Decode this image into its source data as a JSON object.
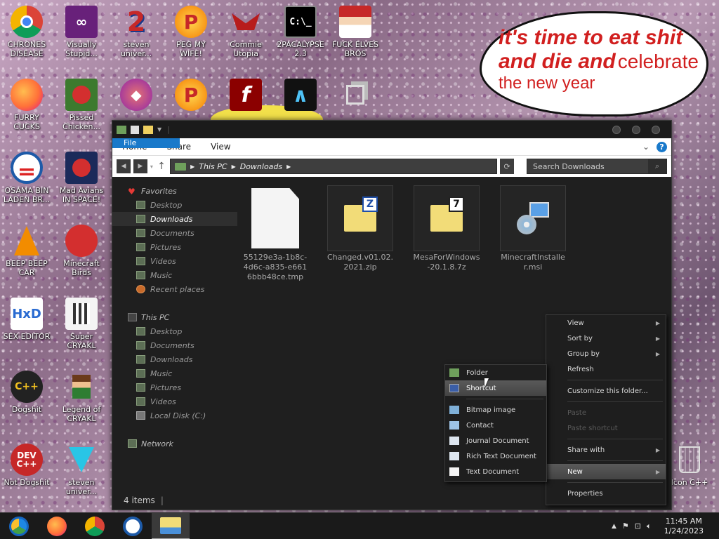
{
  "desktop": {
    "icons": [
      {
        "label": "CHRONES DISEASE",
        "icon": "chrome-icon"
      },
      {
        "label": "Visually Stupid...",
        "icon": "visual-studio-icon"
      },
      {
        "label": "steven univer...",
        "icon": "number-2-icon"
      },
      {
        "label": "PEG MY WIFE!",
        "icon": "p-letter-icon"
      },
      {
        "label": "Commie Utopia",
        "icon": "red-bird-icon"
      },
      {
        "label": "2PACALYPSE 2.3",
        "icon": "console-icon"
      },
      {
        "label": "FUCK ELVES BROS",
        "icon": "santa-icon"
      },
      {
        "label": "FURRY CUCKS",
        "icon": "firefox-icon"
      },
      {
        "label": "Pissed Chicken...",
        "icon": "angry-birds-seasons-icon"
      },
      {
        "label": "OSAMA BIN LADEN BR...",
        "icon": "obama-logo-icon"
      },
      {
        "label": "Mad Avians IN SPACE!",
        "icon": "angry-birds-space-icon"
      },
      {
        "label": "BEEP BEEP CAR",
        "icon": "vlc-cone-icon"
      },
      {
        "label": "Minecraft Birds",
        "icon": "angry-bird-icon"
      },
      {
        "label": "SEX EDITOR",
        "icon": "hxd-icon"
      },
      {
        "label": "Super CRYAKL",
        "icon": "pixel-character-icon"
      },
      {
        "label": "Dogshit",
        "icon": "cpp-dog-icon"
      },
      {
        "label": "Legend of CRYAKL",
        "icon": "pixel-hero-icon"
      },
      {
        "label": "Not Dogshit",
        "icon": "dev-cpp-icon"
      },
      {
        "label": "steven univer...",
        "icon": "gem-icon"
      },
      {
        "label": "Icon C++",
        "icon": "recycle-bin-icon"
      }
    ]
  },
  "bubble": {
    "line1": "it's time to eat shit",
    "line2a": "and die and",
    "line2b": "celebrate",
    "line3": "the new year"
  },
  "explorer": {
    "ribbon_tabs": [
      "File",
      "Home",
      "Share",
      "View"
    ],
    "breadcrumb": [
      "This PC",
      "Downloads"
    ],
    "search_placeholder": "Search Downloads",
    "nav": {
      "favorites": "Favorites",
      "favorites_items": [
        "Desktop",
        "Downloads",
        "Documents",
        "Pictures",
        "Videos",
        "Music",
        "Recent places"
      ],
      "this_pc": "This PC",
      "this_pc_items": [
        "Desktop",
        "Documents",
        "Downloads",
        "Music",
        "Pictures",
        "Videos",
        "Local Disk (C:)"
      ],
      "network": "Network",
      "selected": "Downloads"
    },
    "files": [
      {
        "name": "55129e3a-1b8c-4d6c-a835-e6616bbb48ce.tmp",
        "type": "tmp"
      },
      {
        "name": "Changed.v01.02.2021.zip",
        "type": "zip"
      },
      {
        "name": "MesaForWindows-20.1.8.7z",
        "type": "7z"
      },
      {
        "name": "MinecraftInstaller.msi",
        "type": "msi"
      }
    ],
    "status": "4 items"
  },
  "context_menu": {
    "items": [
      {
        "label": "View",
        "submenu": true,
        "enabled": true
      },
      {
        "label": "Sort by",
        "submenu": true,
        "enabled": true
      },
      {
        "label": "Group by",
        "submenu": true,
        "enabled": true
      },
      {
        "label": "Refresh",
        "submenu": false,
        "enabled": true
      },
      {
        "label": "Customize this folder...",
        "submenu": false,
        "enabled": true
      },
      {
        "label": "Paste",
        "submenu": false,
        "enabled": false
      },
      {
        "label": "Paste shortcut",
        "submenu": false,
        "enabled": false
      },
      {
        "label": "Share with",
        "submenu": true,
        "enabled": true
      },
      {
        "label": "New",
        "submenu": true,
        "enabled": true
      },
      {
        "label": "Properties",
        "submenu": false,
        "enabled": true
      }
    ]
  },
  "new_submenu": {
    "items": [
      "Folder",
      "Shortcut",
      "Bitmap image",
      "Contact",
      "Journal Document",
      "Rich Text Document",
      "Text Document"
    ]
  },
  "taskbar": {
    "apps": [
      "chromium-icon",
      "firefox-icon",
      "chrome-icon",
      "obama-logo-icon",
      "file-explorer-icon"
    ],
    "time": "11:45 AM",
    "date": "1/24/2023"
  },
  "colors": {
    "accent": "#1979ca",
    "window_bg": "#1f1f1f",
    "bubble_text": "#d11f1f"
  }
}
